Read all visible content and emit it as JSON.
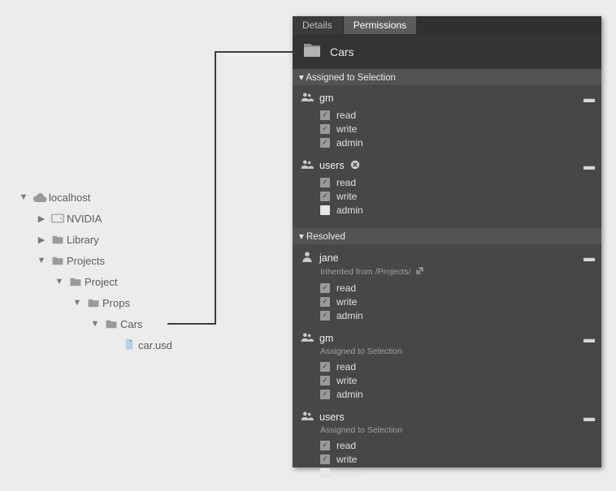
{
  "tree": {
    "localhost": {
      "label": "localhost",
      "expanded": true
    },
    "nvidia": {
      "label": "NVIDIA",
      "expanded": false
    },
    "library": {
      "label": "Library",
      "expanded": false
    },
    "projects": {
      "label": "Projects",
      "expanded": true
    },
    "project": {
      "label": "Project",
      "expanded": true
    },
    "props": {
      "label": "Props",
      "expanded": true
    },
    "cars": {
      "label": "Cars",
      "expanded": true
    },
    "carusd": {
      "label": "car.usd"
    }
  },
  "tabs": {
    "details": "Details",
    "permissions": "Permissions"
  },
  "breadcrumb": {
    "title": "Cars"
  },
  "sections": {
    "assigned_header": "Assigned to Selection",
    "resolved_header": "Resolved"
  },
  "assigned": [
    {
      "type": "group",
      "name": "gm",
      "removable": false,
      "perms": {
        "read": true,
        "write": true,
        "admin": true
      }
    },
    {
      "type": "group",
      "name": "users",
      "removable": true,
      "perms": {
        "read": true,
        "write": true,
        "admin": false
      }
    }
  ],
  "resolved": [
    {
      "type": "user",
      "name": "jane",
      "meta": {
        "text": "Inherited from /Projects/",
        "external": true
      },
      "perms": {
        "read": true,
        "write": true,
        "admin": true
      }
    },
    {
      "type": "group",
      "name": "gm",
      "meta": {
        "text": "Assigned to Selection"
      },
      "perms": {
        "read": true,
        "write": true,
        "admin": true
      }
    },
    {
      "type": "group",
      "name": "users",
      "meta": {
        "text": "Assigned to Selection"
      },
      "perms": {
        "read": true,
        "write": true,
        "admin": false
      }
    }
  ],
  "perm_labels": {
    "read": "read",
    "write": "write",
    "admin": "admin"
  },
  "ui": {
    "collapse_glyph": "▬",
    "caret_expanded": "▼",
    "caret_collapsed": "▶",
    "section_caret": "▾"
  }
}
